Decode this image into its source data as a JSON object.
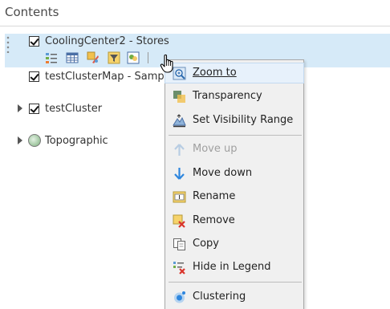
{
  "panel": {
    "title": "Contents"
  },
  "layers": [
    {
      "name": "CoolingCenter2 - Stores",
      "checked": true,
      "selected": true
    },
    {
      "name": "testClusterMap - Sample",
      "checked": true
    },
    {
      "name": "testCluster",
      "checked": true
    },
    {
      "name": "Topographic",
      "checked": false
    }
  ],
  "layer_tools": [
    "show-legend-icon",
    "show-table-icon",
    "change-style-icon",
    "filter-icon",
    "perform-analysis-icon"
  ],
  "context_menu": {
    "items": [
      {
        "label": "Zoom to",
        "icon": "zoom-to-icon"
      },
      {
        "label": "Transparency",
        "icon": "transparency-icon"
      },
      {
        "label": "Set Visibility Range",
        "icon": "visibility-range-icon"
      },
      {
        "label": "Move up",
        "icon": "move-up-icon",
        "disabled": true
      },
      {
        "label": "Move down",
        "icon": "move-down-icon"
      },
      {
        "label": "Rename",
        "icon": "rename-icon"
      },
      {
        "label": "Remove",
        "icon": "remove-icon"
      },
      {
        "label": "Copy",
        "icon": "copy-icon"
      },
      {
        "label": "Hide in Legend",
        "icon": "hide-in-legend-icon"
      },
      {
        "label": "Clustering",
        "icon": "clustering-icon"
      }
    ]
  },
  "colors": {
    "selection": "#d6eaf8",
    "menu_bg": "#f0f0f0",
    "accent_blue": "#2e86de"
  }
}
